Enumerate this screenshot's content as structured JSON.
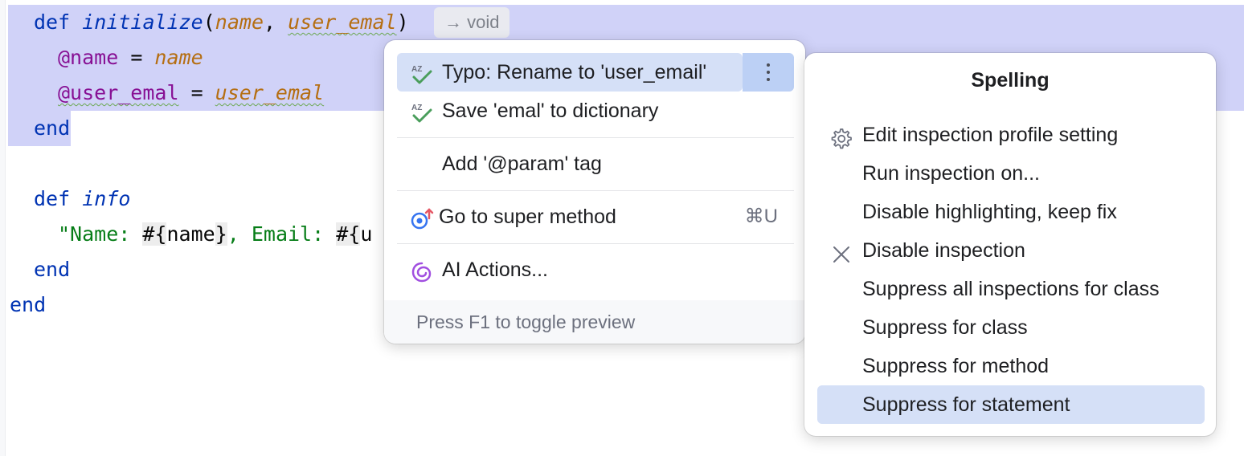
{
  "editor": {
    "lines": [
      {
        "tokens": [
          "def ",
          "initialize",
          "(",
          "name",
          ", ",
          "user_emal",
          ")"
        ]
      },
      {
        "tokens": [
          "@name",
          " = ",
          "name"
        ]
      },
      {
        "tokens": [
          "@user_emal",
          " = ",
          "user_emal"
        ]
      },
      {
        "tokens": [
          "end"
        ]
      },
      {
        "tokens": [
          "def ",
          "info"
        ]
      },
      {
        "tokens": [
          "\"Name: ",
          "#{",
          "name",
          "}",
          ", Email: ",
          "#{",
          "u"
        ]
      },
      {
        "tokens": [
          "end"
        ]
      },
      {
        "tokens": [
          "end"
        ]
      }
    ],
    "inlay_hint": "→ void"
  },
  "intention_popup": {
    "items": [
      {
        "label": "Typo: Rename to 'user_email'",
        "icon": "spellcheck-icon"
      },
      {
        "label": "Save 'emal' to dictionary",
        "icon": "spellcheck-icon"
      },
      {
        "label": "Add '@param' tag",
        "icon": ""
      },
      {
        "label": "Go to super method",
        "icon": "super-method-icon",
        "shortcut": "⌘U"
      },
      {
        "label": "AI Actions...",
        "icon": "ai-spiral-icon"
      }
    ],
    "footer": "Press F1 to toggle preview"
  },
  "submenu": {
    "title": "Spelling",
    "items": [
      {
        "label": "Edit inspection profile setting",
        "icon": "gear-icon"
      },
      {
        "label": "Run inspection on...",
        "icon": ""
      },
      {
        "label": "Disable highlighting, keep fix",
        "icon": ""
      },
      {
        "label": "Disable inspection",
        "icon": "close-icon"
      },
      {
        "label": "Suppress all inspections for class",
        "icon": ""
      },
      {
        "label": "Suppress for class",
        "icon": ""
      },
      {
        "label": "Suppress for method",
        "icon": ""
      },
      {
        "label": "Suppress for statement",
        "icon": ""
      }
    ]
  },
  "colors": {
    "selection": "#d0d2f8",
    "keyword": "#0033b3",
    "parameter": "#b56e12",
    "instance_var": "#871094",
    "string": "#067d17",
    "highlight_item": "#d5e0f7"
  }
}
